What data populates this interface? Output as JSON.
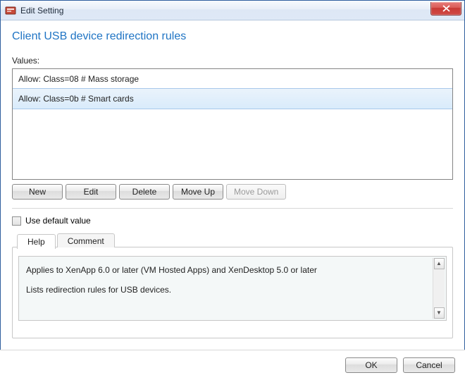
{
  "window": {
    "title": "Edit Setting"
  },
  "heading": "Client USB device redirection rules",
  "values_label": "Values:",
  "values": {
    "items": [
      {
        "text": "Allow: Class=08 # Mass storage",
        "selected": false
      },
      {
        "text": "Allow: Class=0b # Smart cards",
        "selected": true
      }
    ]
  },
  "buttons": {
    "new": "New",
    "edit": "Edit",
    "delete": "Delete",
    "move_up": "Move Up",
    "move_down": "Move Down"
  },
  "use_default_label": "Use default value",
  "use_default_checked": false,
  "tabs": {
    "help": "Help",
    "comment": "Comment",
    "active": "help"
  },
  "help_body": {
    "line1": "Applies to XenApp 6.0 or later (VM Hosted Apps) and XenDesktop 5.0 or later",
    "line2": "Lists redirection rules for USB devices."
  },
  "footer": {
    "ok": "OK",
    "cancel": "Cancel"
  }
}
